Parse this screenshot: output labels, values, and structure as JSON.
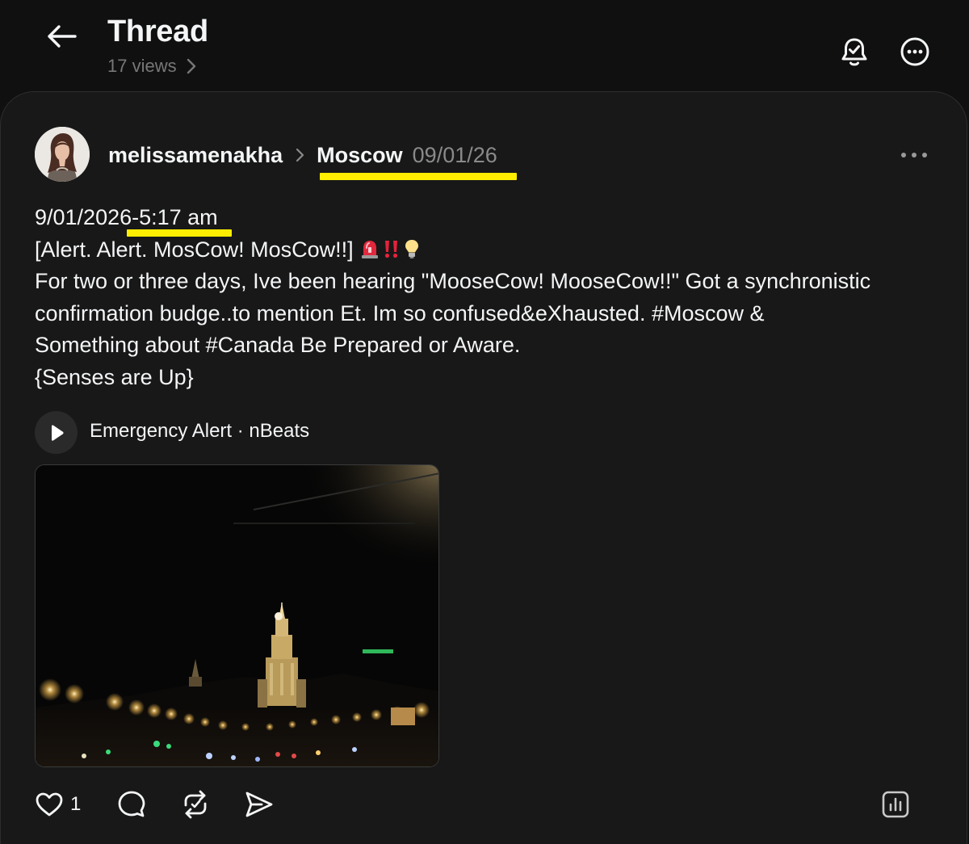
{
  "header": {
    "title": "Thread",
    "views": "17 views"
  },
  "post": {
    "username": "melissamenakha",
    "topic": "Moscow",
    "date": "09/01/26",
    "lines": [
      "9/01/2026-5:17 am",
      "[Alert. Alert. MosCow! MosCow!!]",
      "For two or three days, Ive been hearing \"MooseCow! MooseCow!!\" Got a synchronistic",
      "confirmation budge..to mention Et. Im so confused&eXhausted. #Moscow &",
      "Something about #Canada Be Prepared or Aware.",
      "{Senses are Up}"
    ],
    "emoji": [
      "police-light-icon",
      "double-exclamation-icon",
      "lightbulb-icon"
    ],
    "music": {
      "label": "Emergency Alert · nBeats"
    },
    "like_count": "1"
  },
  "colors": {
    "background": "#101010",
    "card": "#181818",
    "text": "#f3f5f7",
    "muted": "#777777",
    "highlight": "#ffee00"
  }
}
